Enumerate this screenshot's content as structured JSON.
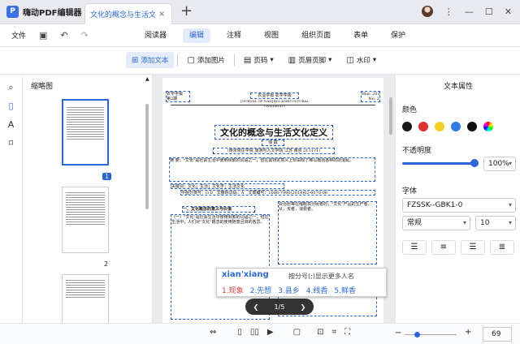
{
  "app": {
    "name": "嗨动PDF编辑器"
  },
  "tab": {
    "title": "文化的概念与生活文化...",
    "close": "×",
    "new": "+"
  },
  "window": {
    "menu": "⋮",
    "min": "—",
    "max": "☐",
    "close": "✕"
  },
  "menubar": {
    "file": "文件",
    "tabs": [
      "阅读器",
      "编辑",
      "注释",
      "视图",
      "组织页面",
      "表单",
      "保护"
    ],
    "active": "编辑"
  },
  "toolbar": {
    "add_text": "添加文本",
    "add_image": "添加图片",
    "page_label": "页码",
    "header_footer": "页眉页脚",
    "watermark": "水印"
  },
  "thumbs": {
    "header": "缩略图",
    "page1": "1",
    "page2": "2"
  },
  "document": {
    "box_left": "农学学报\n第2期",
    "box_center": "农业学报 农学学报",
    "journal": "JOURNAL OF NANJING AGRICULTURAL UNIVERSITY",
    "date": "Mar. 2014\nNo. 2",
    "title": "文化的概念与生活文化定义",
    "author": "徐 斌",
    "affil": "（南京晓庄学院 旅游与人文学院 江苏 南京 211171）",
    "abstract": "摘 要：\"文化\"是社会生活中使用频繁的词语之一，但在其特定意义上却由现了难以概括各种的的混乱。",
    "keywords": "关键词：文化；生活；文化学；生活文化",
    "clc": "中图分类号：G 0　文献标识码：A　文章编号：1008-7990(2014)02-0070-06",
    "section": "一、文化概念的意义与价值",
    "left_col": "（一）\"文化\"是社会生活中使用频繁的词语之一，但在生活中，人们对\"文化\"概念的使用随意且目的各异。",
    "right_col": "会治愈等在缩概高分民者的，\"文化\"产品的生产者、从，买者，消费者。",
    "section2": "（二）内涵：从不同的角度进行\"文化\"的研究"
  },
  "ime": {
    "pinyin": "xian'xiang",
    "hint": "按分号(;)显示更多人名",
    "candidates": [
      "1.现象",
      "2.先想",
      "3.县乡",
      "4.线香",
      "5.鲜香"
    ]
  },
  "pager": {
    "prev": "❮",
    "label": "1/5",
    "next": "❯"
  },
  "props": {
    "title": "文本属性",
    "color_label": "颜色",
    "colors": [
      "#1a1a1a",
      "#e03131",
      "#f5d020",
      "#2f7be6",
      "#111111"
    ],
    "opacity_label": "不透明度",
    "opacity": "100%",
    "font_label": "字体",
    "font": "FZSSK--GBK1-0",
    "style": "常规",
    "size": "10"
  },
  "status": {
    "zoom": "69"
  }
}
